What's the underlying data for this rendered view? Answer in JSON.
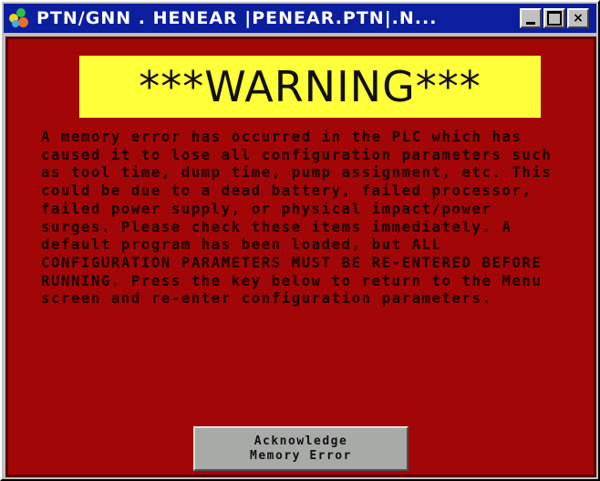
{
  "window": {
    "title": "PTN/GNN . HENEAR |PENEAR.PTN|.N...",
    "buttons": {
      "minimize": "minimize",
      "maximize": "maximize",
      "close": "×"
    }
  },
  "banner": {
    "text": "***WARNING***"
  },
  "message": {
    "text": "A memory error has occurred in the PLC which has caused it to lose all configuration parameters such as tool time, dump time, pump assignment, etc. This could be due to a dead battery, failed processor, failed power supply, or physical impact/power surges. Please check these items immediately. A default program has been loaded, but ALL CONFIGURATION PARAMETERS MUST BE RE-ENTERED BEFORE RUNNING. Press the key below to return to the Menu screen and re-enter configuration parameters."
  },
  "acknowledge": {
    "line1": "Acknowledge",
    "line2": "Memory Error"
  },
  "colors": {
    "titlebar": "#0a1e9e",
    "background": "#a30606",
    "banner": "#ffff3a",
    "button": "#a8aaa8"
  },
  "icons": {
    "app": "leaf-app-icon"
  }
}
